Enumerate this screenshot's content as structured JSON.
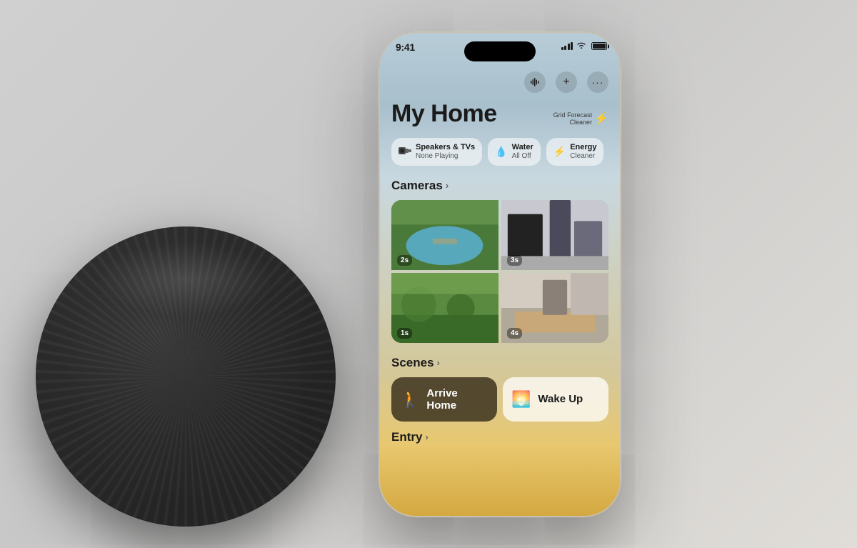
{
  "page": {
    "background_color": "#d4d0cc"
  },
  "status_bar": {
    "time": "9:41",
    "signal_label": "signal",
    "wifi_label": "wifi",
    "battery_label": "battery"
  },
  "action_bar": {
    "siri_icon": "waveform",
    "add_icon": "+",
    "more_icon": "⋯"
  },
  "grid_forecast": {
    "line1": "Grid Forecast",
    "line2": "Cleaner",
    "icon": "⚡"
  },
  "home_title": "My Home",
  "chips": [
    {
      "icon": "🖥",
      "label": "Speakers & TVs",
      "sublabel": "None Playing"
    },
    {
      "icon": "💧",
      "label": "Water",
      "sublabel": "All Off"
    },
    {
      "icon": "⚡",
      "label": "Energy",
      "sublabel": "Cleaner"
    }
  ],
  "cameras": {
    "section_label": "Cameras",
    "arrow": "›",
    "items": [
      {
        "timer": "2s"
      },
      {
        "timer": "3s"
      },
      {
        "timer": "1s"
      },
      {
        "timer": "4s"
      }
    ]
  },
  "scenes": {
    "section_label": "Scenes",
    "arrow": "›",
    "items": [
      {
        "icon": "🚶",
        "label": "Arrive Home",
        "style": "dark"
      },
      {
        "icon": "🌅",
        "label": "Wake Up",
        "style": "light"
      }
    ]
  },
  "entry": {
    "section_label": "Entry",
    "arrow": "›"
  }
}
